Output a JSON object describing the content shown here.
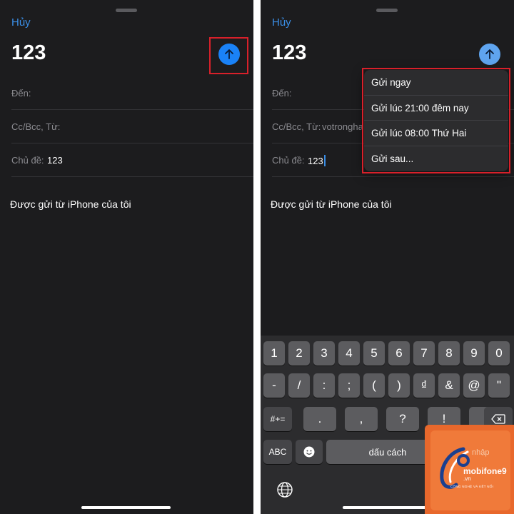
{
  "left_screen": {
    "cancel_label": "Hủy",
    "subject_title": "123",
    "fields": {
      "to_label": "Đến:",
      "ccbcc_label": "Cc/Bcc, Từ:",
      "subject_label": "Chủ đề:",
      "subject_value": "123"
    },
    "body_signature": "Được gửi từ iPhone của tôi"
  },
  "right_screen": {
    "cancel_label": "Hủy",
    "subject_title": "123",
    "fields": {
      "to_label": "Đến:",
      "ccbcc_label": "Cc/Bcc, Từ:",
      "from_value": "votrongha",
      "subject_label": "Chủ đề:",
      "subject_value": "123"
    },
    "body_signature": "Được gửi từ iPhone của tôi",
    "send_menu": [
      "Gửi ngay",
      "Gửi lúc 21:00 đêm nay",
      "Gửi lúc 08:00 Thứ Hai",
      "Gửi sau..."
    ],
    "keyboard": {
      "row1": [
        "1",
        "2",
        "3",
        "4",
        "5",
        "6",
        "7",
        "8",
        "9",
        "0"
      ],
      "row2": [
        "-",
        "/",
        ":",
        ";",
        "(",
        ")",
        "₫",
        "&",
        "@",
        "\""
      ],
      "row3_left": "#+=",
      "row3": [
        ".",
        ",",
        "?",
        "!",
        "'"
      ],
      "abc_label": "ABC",
      "space_label": "dấu cách",
      "return_label": "nhập"
    }
  },
  "watermark": {
    "brand": "mobifone9",
    "domain": ".vn",
    "tagline": "CÔNG NGHỆ VÀ KẾT NỐI"
  },
  "colors": {
    "background": "#1c1c1e",
    "accent": "#1a82f7",
    "highlight": "#d8202a",
    "watermark": "#e8682c"
  }
}
